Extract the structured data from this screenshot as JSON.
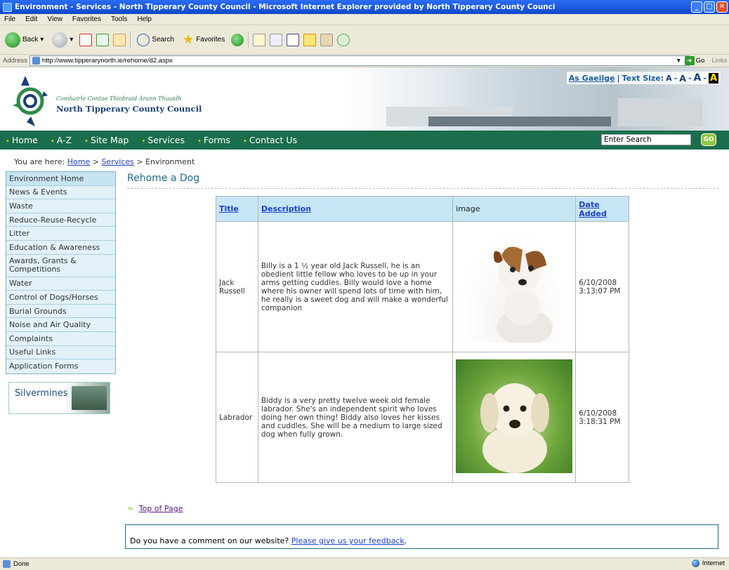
{
  "window": {
    "title": "Environment - Services - North Tipperary County Council - Microsoft Internet Explorer provided by North Tipperary County Counci"
  },
  "menu": [
    "File",
    "Edit",
    "View",
    "Favorites",
    "Tools",
    "Help"
  ],
  "toolbar": {
    "back": "Back",
    "search": "Search",
    "favorites": "Favorites"
  },
  "address": {
    "label": "Address",
    "url": "http://www.tipperarynorth.ie/rehome/d2.aspx",
    "go": "Go",
    "links": "Links"
  },
  "header": {
    "org_irish": "Comhairle Contae Thiobraid Árann Thuaidh",
    "org_name": "North Tipperary County Council",
    "as_gaeilge": "As Gaeilge",
    "text_size_label": "Text Size:",
    "text_size_a1": "A",
    "text_size_a2": "A",
    "text_size_a3": "A",
    "text_size_a4": "A"
  },
  "nav": [
    "Home",
    "A-Z",
    "Site Map",
    "Services",
    "Forms",
    "Contact Us"
  ],
  "search": {
    "value": "Enter Search",
    "go": "GO"
  },
  "breadcrumb": {
    "prefix": "You are here:",
    "home": "Home",
    "services": "Services",
    "current": "Environment"
  },
  "sidebar": {
    "items": [
      "Environment Home",
      "News & Events",
      "Waste",
      "Reduce-Reuse-Recycle",
      "Litter",
      "Education & Awareness",
      "Awards, Grants & Competitions",
      "Water",
      "Control of Dogs/Horses",
      "Burial Grounds",
      "Noise and Air Quality",
      "Complaints",
      "Useful Links",
      "Application Forms"
    ],
    "promo": "Silvermines"
  },
  "main": {
    "title": "Rehome a Dog",
    "columns": {
      "title": "Title",
      "description": "Description",
      "image": "image",
      "date": "Date Added"
    },
    "rows": [
      {
        "title": "Jack Russell",
        "description": "Billy is a 1 ½ year old Jack Russell, he is an obedient little fellow who loves to be up in your arms getting cuddles. Billy would love a home where his owner will spend lots of time with him, he really is a sweet dog and will make a wonderful companion",
        "date": "6/10/2008 3:13:07 PM"
      },
      {
        "title": "Labrador",
        "description": "Biddy is a very pretty twelve week old female labrador. She's an independent spirit who loves doing her own thing! Biddy also loves her kisses and cuddles. She will be a medium to large sized dog when fully grown.",
        "date": "6/10/2008 3:18:31 PM"
      }
    ],
    "top_of_page": "Top of Page",
    "feedback_text": "Do you have a comment on our website?",
    "feedback_link": "Please give us your feedback",
    "feedback_end": "."
  },
  "status": {
    "left": "Done",
    "zone": "Internet"
  },
  "colors": {
    "nav_green": "#1b6e4d",
    "link_blue": "#1a3fcf",
    "table_header": "#c6e6f6"
  }
}
